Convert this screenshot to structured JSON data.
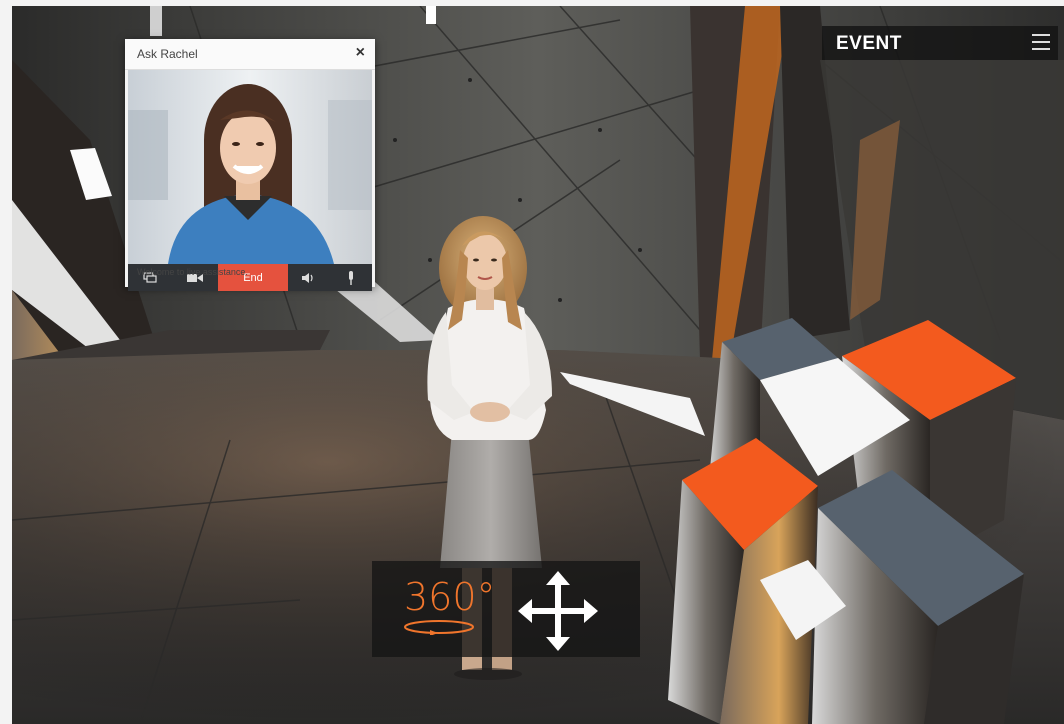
{
  "header": {
    "title": "EVENT",
    "menu_icon": "hamburger-menu-icon"
  },
  "assistant_panel": {
    "title": "Ask Rachel",
    "close_icon": "close-icon",
    "controls": [
      {
        "name": "chat",
        "icon": "chat-icon"
      },
      {
        "name": "video",
        "icon": "video-camera-icon"
      },
      {
        "name": "end",
        "label": "End",
        "color": "#e5523e"
      },
      {
        "name": "volume",
        "icon": "volume-icon"
      },
      {
        "name": "microphone",
        "icon": "microphone-icon"
      }
    ],
    "status_text": "Welcome to live assistance."
  },
  "navigation_overlay": {
    "rotate_label": "360°",
    "rotate_icon": "rotate-360-icon",
    "move_icon": "move-arrows-icon",
    "accent_color": "#f0752c"
  },
  "scene": {
    "cube_accent_color": "#f35a1e",
    "cube_gray_color": "#57626e"
  }
}
